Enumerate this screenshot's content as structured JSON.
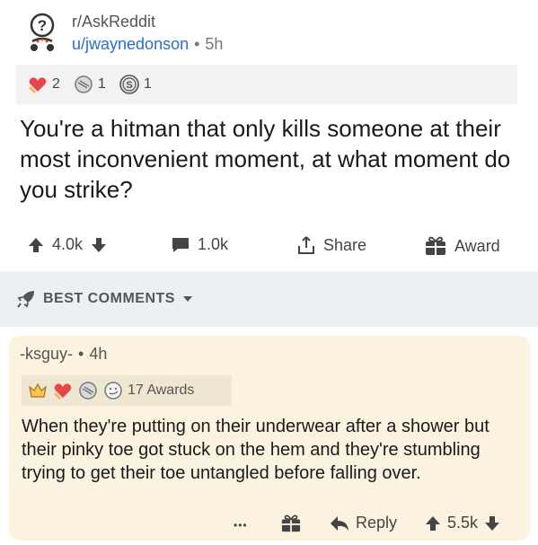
{
  "post": {
    "subreddit": "r/AskReddit",
    "author": "u/jwaynedonson",
    "separator": "•",
    "age": "5h",
    "awards": [
      {
        "icon": "heart-hands-award-icon",
        "count": "2"
      },
      {
        "icon": "facepalm-award-icon",
        "count": "1"
      },
      {
        "icon": "silver-award-icon",
        "count": "1"
      }
    ],
    "title": "You're a hitman that only kills someone at their most inconvenient moment, at what moment do you strike?"
  },
  "actions": {
    "score": "4.0k",
    "comments": "1.0k",
    "share": "Share",
    "award": "Award"
  },
  "sort": {
    "label": "BEST COMMENTS"
  },
  "comment": {
    "author": "-ksguy-",
    "separator": "•",
    "age": "4h",
    "awards_label": "17 Awards",
    "body": "When they're putting on their underwear after a shower but their pinky toe got stuck on the hem and they're stumbling trying to get their toe untangled before falling over.",
    "more": "•••",
    "reply": "Reply",
    "score": "5.5k"
  },
  "colors": {
    "link_blue": "#2a6fc9",
    "comment_bg": "#fbf3df",
    "sort_bg": "#eceff3",
    "award_strip_bg": "#f2f2f2",
    "icon_gray": "#555555"
  }
}
